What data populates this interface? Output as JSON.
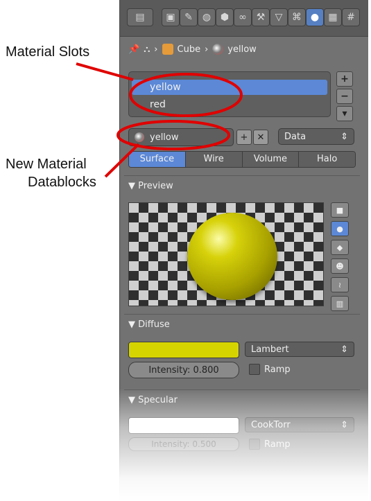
{
  "annotations": {
    "material_slots": "Material Slots",
    "new_material_line1": "New Material",
    "new_material_line2": "Datablocks"
  },
  "toolbar": {
    "icons": [
      "render-icon",
      "render-layers-icon",
      "scene-icon",
      "world-icon",
      "object-icon",
      "constraints-icon",
      "modifiers-icon",
      "data-icon",
      "material-icon",
      "texture-icon",
      "physics-icon"
    ],
    "active": "material-icon"
  },
  "breadcrumb": {
    "object": "Cube",
    "material": "yellow"
  },
  "slots": {
    "items": [
      "yellow",
      "red"
    ],
    "selected": "yellow"
  },
  "material": {
    "name": "yellow",
    "link": "Data"
  },
  "tabs": [
    "Surface",
    "Wire",
    "Volume",
    "Halo"
  ],
  "active_tab": "Surface",
  "preview": {
    "label": "Preview"
  },
  "diffuse": {
    "label": "Diffuse",
    "color": "#d6d400",
    "shader": "Lambert",
    "intensity": "Intensity: 0.800",
    "ramp": "Ramp"
  },
  "specular": {
    "label": "Specular",
    "color": "#ffffff",
    "shader": "CookTorr",
    "intensity": "Intensity: 0.500",
    "ramp": "Ramp"
  },
  "colors": {
    "selection": "#5c88d6",
    "annotation": "#e00000",
    "panel": "#727272"
  }
}
